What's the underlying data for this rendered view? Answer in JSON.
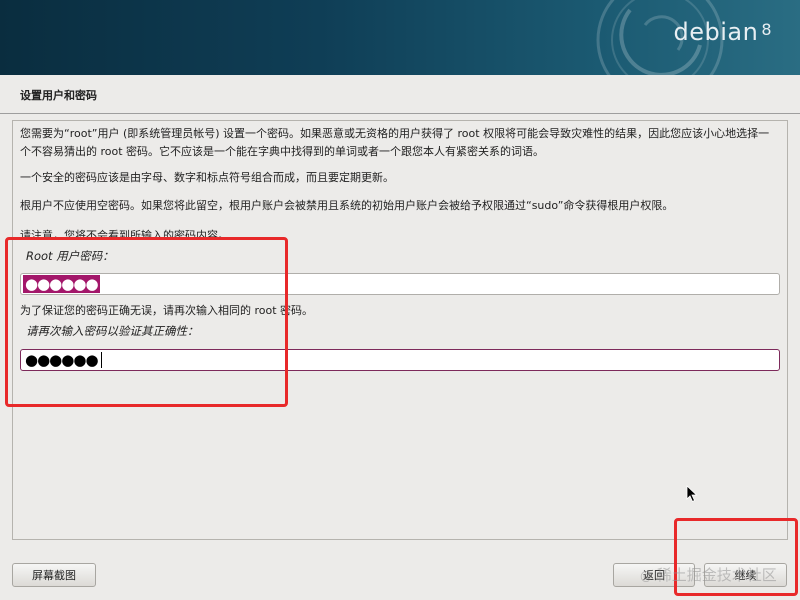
{
  "header": {
    "brand": "debian",
    "version": "8"
  },
  "page_title": "设置用户和密码",
  "paragraphs": {
    "p1": "您需要为“root”用户 (即系统管理员帐号) 设置一个密码。如果恶意或无资格的用户获得了 root 权限将可能会导致灾难性的结果，因此您应该小心地选择一个不容易猜出的 root 密码。它不应该是一个能在字典中找得到的单词或者一个跟您本人有紧密关系的词语。",
    "p2": "一个安全的密码应该是由字母、数字和标点符号组合而成，而且要定期更新。",
    "p3": "根用户不应使用空密码。如果您将此留空，根用户账户会被禁用且系统的初始用户账户会被给予权限通过“sudo”命令获得根用户权限。",
    "p4": "请注意，您将不会看到所输入的密码内容。"
  },
  "root_password": {
    "label": "Root 用户密码：",
    "value": "●●●●●●"
  },
  "verify_hint": "为了保证您的密码正确无误，请再次输入相同的 root 密码。",
  "verify_password": {
    "label": "请再次输入密码以验证其正确性：",
    "value": "●●●●●●"
  },
  "buttons": {
    "screenshot": "屏幕截图",
    "back": "返回",
    "continue": "继续"
  },
  "watermark": {
    "at": "@",
    "text": "稀土掘金技术社区"
  },
  "colors": {
    "selection": "#a3176a",
    "annotation": "#e8292a",
    "banner": "#0f3e56"
  }
}
